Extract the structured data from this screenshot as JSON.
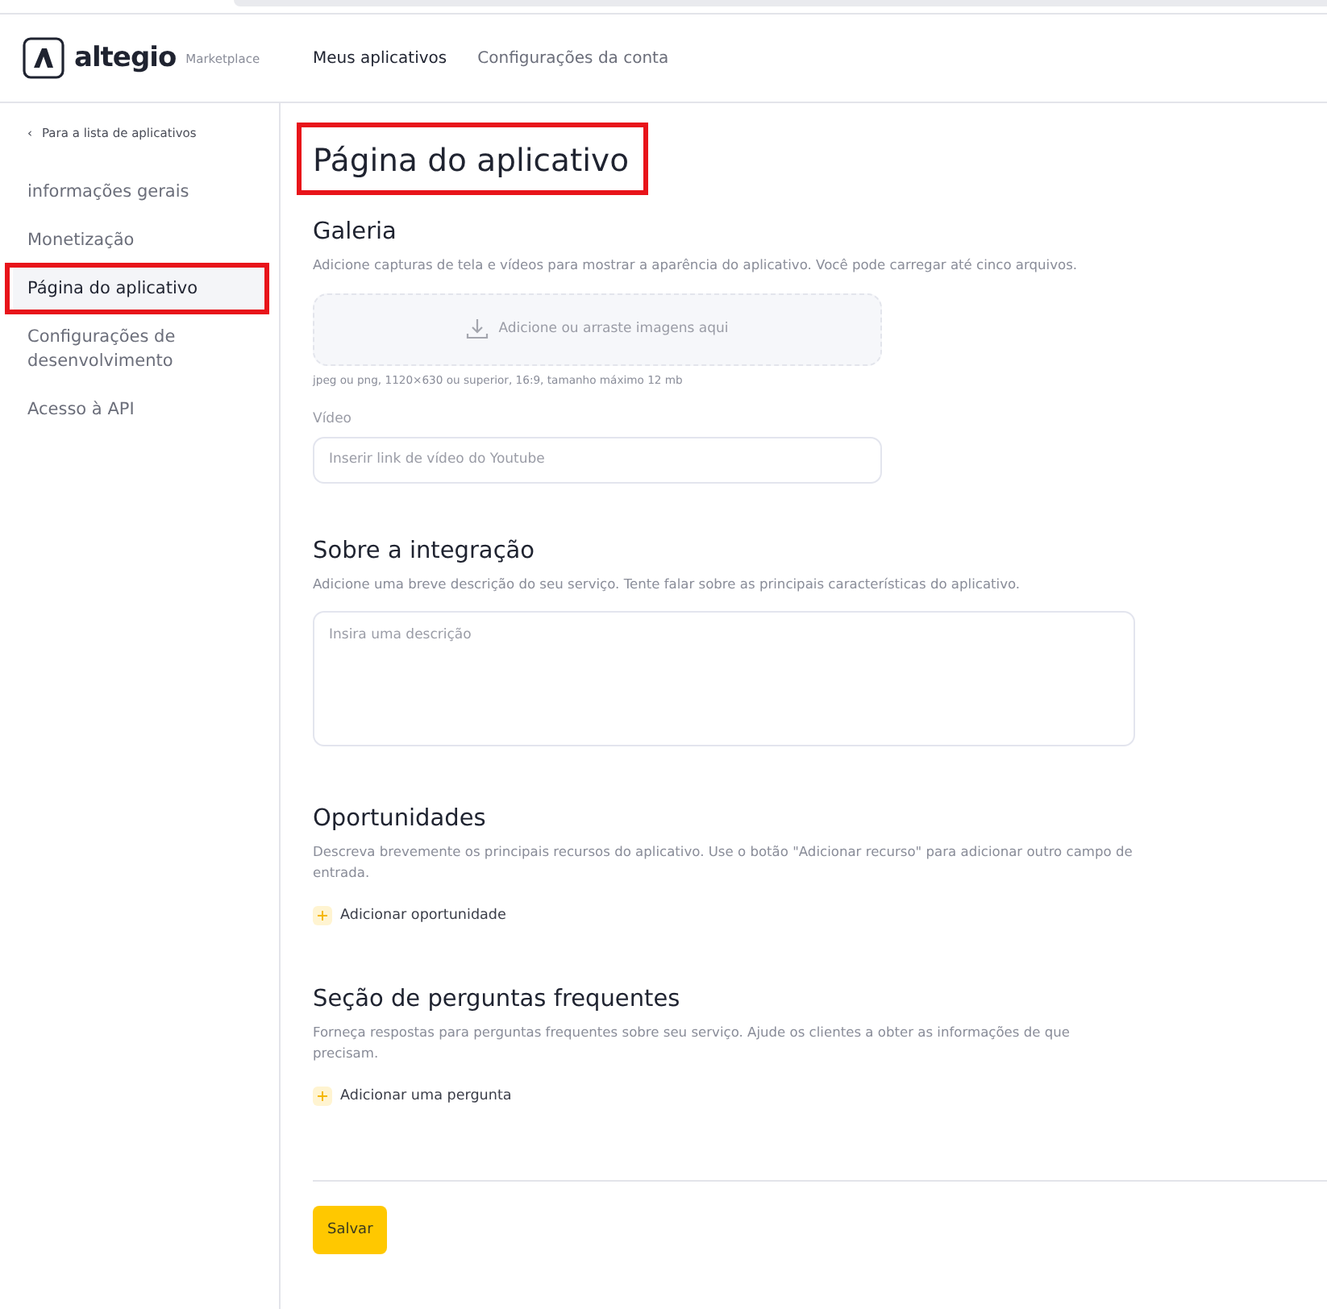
{
  "header": {
    "logo_text": "altegio",
    "logo_subtitle": "Marketplace",
    "nav": [
      {
        "label": "Meus aplicativos",
        "selected": true
      },
      {
        "label": "Configurações da conta",
        "selected": false
      }
    ]
  },
  "sidebar": {
    "back_link": "Para a lista de aplicativos",
    "back_icon": "‹",
    "items": [
      {
        "label": "informações gerais",
        "selected": false,
        "highlighted": false
      },
      {
        "label": "Monetização",
        "selected": false,
        "highlighted": false
      },
      {
        "label": "Página do aplicativo",
        "selected": true,
        "highlighted": true
      },
      {
        "label": "Configurações de desenvolvimento",
        "selected": false,
        "highlighted": false
      },
      {
        "label": "Acesso à API",
        "selected": false,
        "highlighted": false
      }
    ]
  },
  "page": {
    "title": "Página do aplicativo",
    "title_highlighted": true
  },
  "sections": [
    {
      "kind": "gallery",
      "title": "Galeria",
      "description": "Adicione capturas de tela e vídeos para mostrar a aparência do aplicativo. Você pode carregar até cinco arquivos.",
      "upload_label": "Adicione ou arraste imagens aqui",
      "upload_hint": "jpeg ou png, 1120×630 ou superior, 16:9, tamanho máximo 12 mb",
      "video_label": "Vídeo",
      "video_placeholder": "Inserir link de vídeo do Youtube"
    },
    {
      "kind": "text",
      "title": "Sobre a integração",
      "description": "Adicione uma breve descrição do seu serviço. Tente falar sobre as principais características do aplicativo.",
      "placeholder": "Insira uma descrição"
    },
    {
      "kind": "add",
      "title": "Oportunidades",
      "description": "Descreva brevemente os principais recursos do aplicativo. Use o botão \"Adicionar recurso\" para adicionar outro campo de entrada.",
      "add_label": "Adicionar oportunidade"
    },
    {
      "kind": "add",
      "title": "Seção de perguntas frequentes",
      "description": "Forneça respostas para perguntas frequentes sobre seu serviço. Ajude os clientes a obter as informações de que precisam.",
      "add_label": "Adicionar uma pergunta"
    }
  ],
  "save_button": "Salvar"
}
